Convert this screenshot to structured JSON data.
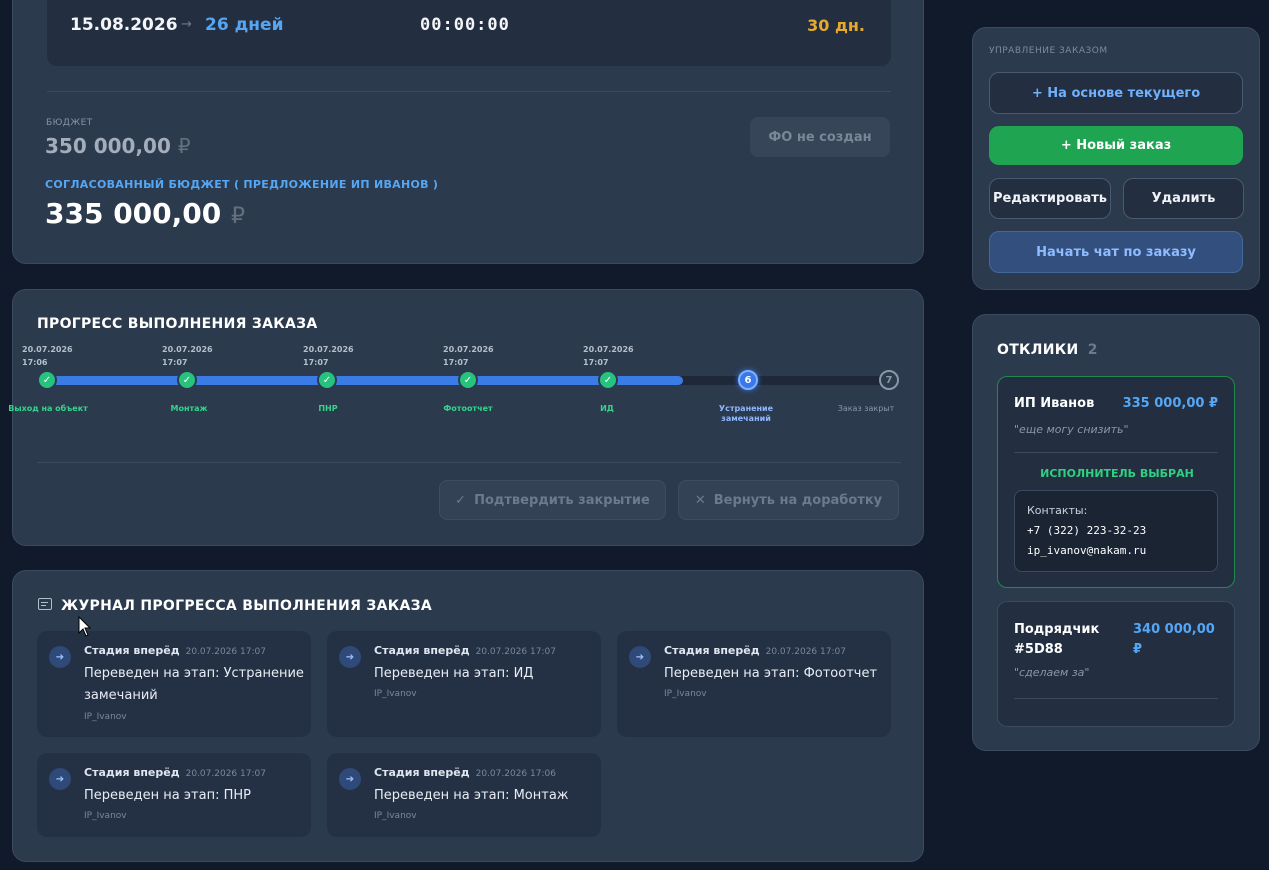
{
  "deadline": {
    "date": "15.08.2026",
    "arrow": "→",
    "days": "26 дней",
    "timer": "00:00:00",
    "days_right": "30 дн."
  },
  "budget": {
    "label": "БЮДЖЕТ",
    "value": "350 000,00",
    "currency": "₽",
    "fo_button": "ФО не создан",
    "agreed_label": "СОГЛАСОВАННЫЙ БЮДЖЕТ ( ПРЕДЛОЖЕНИЕ ИП ИВАНОВ )",
    "agreed_value": "335 000,00"
  },
  "progress": {
    "title": "ПРОГРЕСС ВЫПОЛНЕНИЯ ЗАКАЗА",
    "stages": [
      {
        "date": "20.07.2026",
        "time": "17:06",
        "label": "Выход на объект",
        "status": "done",
        "num": "✓"
      },
      {
        "date": "20.07.2026",
        "time": "17:07",
        "label": "Монтаж",
        "status": "done",
        "num": "✓"
      },
      {
        "date": "20.07.2026",
        "time": "17:07",
        "label": "ПНР",
        "status": "done",
        "num": "✓"
      },
      {
        "date": "20.07.2026",
        "time": "17:07",
        "label": "Фотоотчет",
        "status": "done",
        "num": "✓"
      },
      {
        "date": "20.07.2026",
        "time": "17:07",
        "label": "ИД",
        "status": "done",
        "num": "✓"
      },
      {
        "date": "",
        "time": "",
        "label": "Устранение замечаний",
        "status": "current",
        "num": "6"
      },
      {
        "date": "",
        "time": "",
        "label": "Заказ закрыт",
        "status": "next",
        "num": "7"
      }
    ],
    "confirm_button": "Подтвердить закрытие",
    "return_button": "Вернуть на доработку",
    "check_icon": "✓",
    "cross_icon": "✕"
  },
  "journal": {
    "title": "ЖУРНАЛ ПРОГРЕССА ВЫПОЛНЕНИЯ ЗАКАЗА",
    "items": [
      {
        "head": "Стадия вперёд",
        "time": "20.07.2026 17:07",
        "text": "Переведен на этап: Устранение замечаний",
        "user": "IP_Ivanov"
      },
      {
        "head": "Стадия вперёд",
        "time": "20.07.2026 17:07",
        "text": "Переведен на этап: ИД",
        "user": "IP_Ivanov"
      },
      {
        "head": "Стадия вперёд",
        "time": "20.07.2026 17:07",
        "text": "Переведен на этап: Фотоотчет",
        "user": "IP_Ivanov"
      },
      {
        "head": "Стадия вперёд",
        "time": "20.07.2026 17:07",
        "text": "Переведен на этап: ПНР",
        "user": "IP_Ivanov"
      },
      {
        "head": "Стадия вперёд",
        "time": "20.07.2026 17:06",
        "text": "Переведен на этап: Монтаж",
        "user": "IP_Ivanov"
      }
    ]
  },
  "manage": {
    "title": "УПРАВЛЕНИЕ ЗАКАЗОМ",
    "based_on_current": "+ На основе текущего",
    "new_order": "+ Новый заказ",
    "edit": "Редактировать",
    "delete": "Удалить",
    "chat": "Начать чат по заказу"
  },
  "responses": {
    "title": "ОТКЛИКИ",
    "count": "2",
    "items": [
      {
        "name": "ИП Иванов",
        "price": "335 000,00 ₽",
        "comment": "\"еще могу снизить\"",
        "selected_label": "ИСПОЛНИТЕЛЬ ВЫБРАН",
        "contacts_label": "Контакты:",
        "phone": "+7 (322) 223-32-23",
        "email": "ip_ivanov@nakam.ru"
      },
      {
        "name_line1": "Подрядчик",
        "name_line2": "#5D88",
        "price_line1": "340 000,00",
        "price_line2": "₽",
        "comment": "\"сделаем за\""
      }
    ]
  },
  "colors": {
    "background": "#111a2a",
    "card": "#2c3a4d",
    "accent_blue": "#55a7f5",
    "success_green": "#26c37e",
    "warning_orange": "#e6a92a"
  }
}
